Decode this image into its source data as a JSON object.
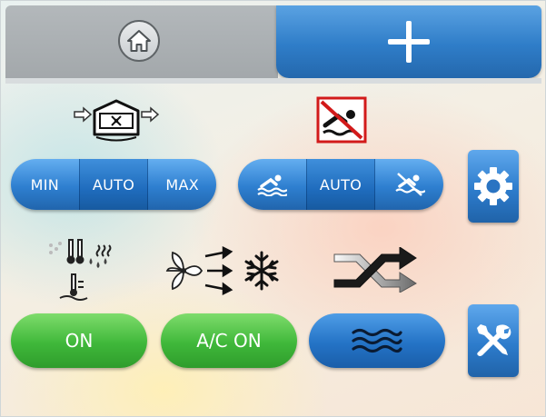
{
  "colors": {
    "accent_blue": "#2e7fd0",
    "accent_green": "#3fb83a",
    "tab_gray": "#a8adb0"
  },
  "topbar": {
    "home_icon": "home-icon",
    "add_icon": "plus-icon"
  },
  "fan_speed": {
    "icon": "ventilation-unit-icon",
    "options": [
      "MIN",
      "AUTO",
      "MAX"
    ],
    "selected": "AUTO"
  },
  "pool": {
    "icon": "no-swimming-icon",
    "options": [
      "swim-icon",
      "AUTO",
      "no-swim-icon"
    ],
    "selected": "AUTO"
  },
  "settings_icon": "gear-icon",
  "heating": {
    "icon": "heating-dehumidify-icon",
    "label": "ON"
  },
  "ac": {
    "icon": "fan-snowflake-icon",
    "label": "A/C ON"
  },
  "mode": {
    "icon": "shuffle-arrows-icon",
    "button_icon": "waves-icon"
  },
  "tools_icon": "tools-icon"
}
